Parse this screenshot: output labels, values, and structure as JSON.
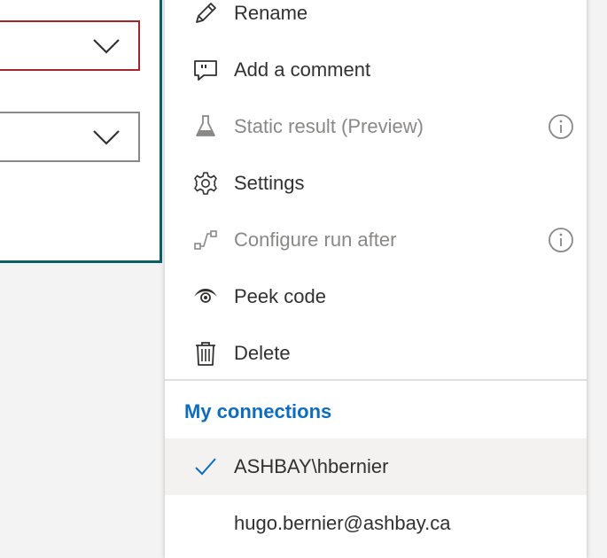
{
  "menu": {
    "items": [
      {
        "label": "Rename",
        "icon": "pencil-icon",
        "disabled": false
      },
      {
        "label": "Add a comment",
        "icon": "comment-icon",
        "disabled": false
      },
      {
        "label": "Static result (Preview)",
        "icon": "flask-icon",
        "disabled": true,
        "info": true
      },
      {
        "label": "Settings",
        "icon": "gear-icon",
        "disabled": false
      },
      {
        "label": "Configure run after",
        "icon": "run-after-icon",
        "disabled": true,
        "info": true
      },
      {
        "label": "Peek code",
        "icon": "eye-icon",
        "disabled": false
      },
      {
        "label": "Delete",
        "icon": "trash-icon",
        "disabled": false
      }
    ],
    "connections_title": "My connections",
    "connections": [
      {
        "label": "ASHBAY\\hbernier",
        "selected": true
      },
      {
        "label": "hugo.bernier@ashbay.ca",
        "selected": false
      }
    ]
  },
  "colors": {
    "accent": "#0f6cbd",
    "card_border": "#0b5f67",
    "error_border": "#a4262c",
    "disabled_text": "#8a8886"
  }
}
